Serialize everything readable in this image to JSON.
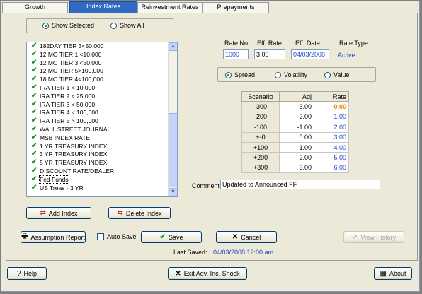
{
  "tabs": [
    "Growth",
    "Index Rates",
    "Reinvestment Rates",
    "Prepayments"
  ],
  "view_options": {
    "selected_label": "Show Selected",
    "all_label": "Show All"
  },
  "index_list": [
    "182DAY TIER 3<50,000",
    "12 MO TIER 1 <10,000",
    "12 MO TIER 3 <50,000",
    "12 MO TIER 5>100,000",
    "18 MO TIER 4<100,000",
    "IRA TIER 1 < 10,000",
    "IRA TIER 2 < 25,000",
    "IRA TIER 3 < 50,000",
    "IRA TIER 4 < 100,000",
    "IRA TIER 5 > 100,000",
    "WALL STREET JOURNAL",
    "MSB INDEX RATE",
    "1 YR TREASURY INDEX",
    "3 YR TREASURY INDEX",
    "5 YR TREASURY INDEX",
    "DISCOUNT RATE/DEALER",
    "Fed Funds",
    "US Treas - 3 YR"
  ],
  "rate_info": {
    "rate_no_label": "Rate No",
    "eff_rate_label": "Eff. Rate",
    "eff_date_label": "Eff. Date",
    "rate_type_label": "Rate Type",
    "rate_no": "1000",
    "eff_rate": "3.00",
    "eff_date": "04/03/2008",
    "rate_type": "Active"
  },
  "shock_type": {
    "spread": "Spread",
    "volatility": "Volatility",
    "value": "Value"
  },
  "scenario_table": {
    "headers": [
      "Scenario",
      "Adj",
      "Rate"
    ],
    "rows": [
      [
        "-300",
        "-3.00",
        "0.00"
      ],
      [
        "-200",
        "-2.00",
        "1.00"
      ],
      [
        "-100",
        "-1.00",
        "2.00"
      ],
      [
        "+-0",
        "0.00",
        "3.00"
      ],
      [
        "+100",
        "1.00",
        "4.00"
      ],
      [
        "+200",
        "2.00",
        "5.00"
      ],
      [
        "+300",
        "3.00",
        "6.00"
      ]
    ]
  },
  "comment": {
    "label": "Comment:",
    "value": "Updated to Announced FF"
  },
  "buttons": {
    "add_index": "Add Index",
    "delete_index": "Delete Index",
    "assumption_report": "Assumption Report",
    "auto_save": "Auto Save",
    "save": "Save",
    "cancel": "Cancel",
    "view_history": "View History",
    "help": "Help",
    "exit": "Exit Adv. Inc. Shock",
    "about": "About"
  },
  "last_saved": {
    "label": "Last Saved:",
    "value": "04/03/2008 12:00 am"
  },
  "colors": {
    "accent_blue": "#1e49c8",
    "highlight_orange": "#e08a00",
    "check_green": "#1c8a2a"
  }
}
